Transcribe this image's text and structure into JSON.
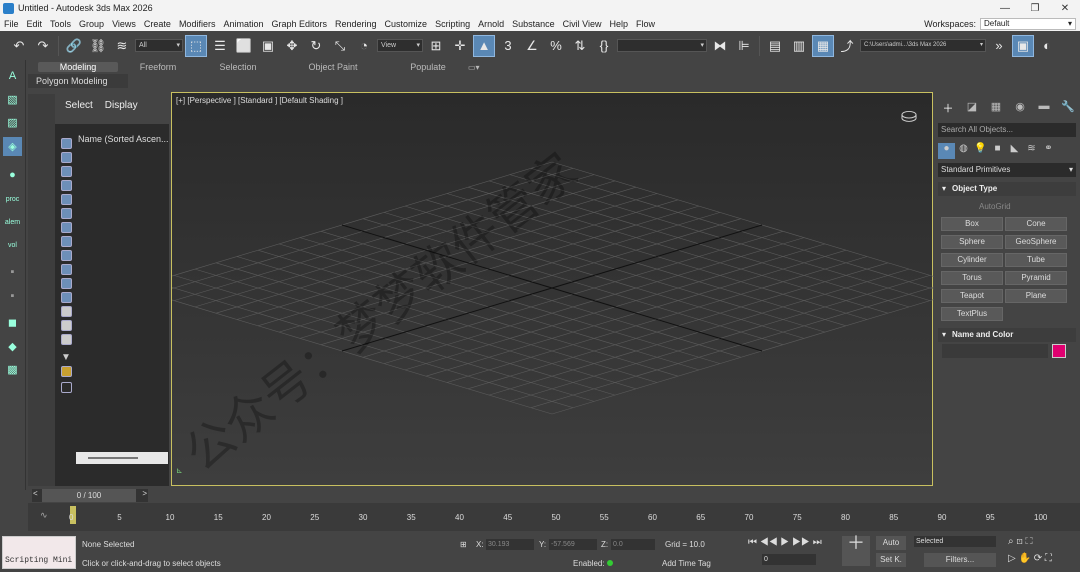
{
  "window": {
    "title": "Untitled - Autodesk 3ds Max 2026"
  },
  "menu": [
    "File",
    "Edit",
    "Tools",
    "Group",
    "Views",
    "Create",
    "Modifiers",
    "Animation",
    "Graph Editors",
    "Rendering",
    "Customize",
    "Scripting",
    "Arnold",
    "Substance",
    "Civil View",
    "Help",
    "Flow"
  ],
  "workspace": {
    "label": "Workspaces:",
    "value": "Default"
  },
  "toolbar": {
    "filter": "All",
    "refcoord": "View",
    "path": "C:\\Users\\admi...\\3ds Max 2026"
  },
  "ribbon": {
    "tabs": [
      "Modeling",
      "Freeform",
      "Selection",
      "Object Paint",
      "Populate"
    ],
    "sub": "Polygon Modeling"
  },
  "scene_explorer": {
    "tabs": [
      "Select",
      "Display"
    ],
    "column": "Name (Sorted Ascen..."
  },
  "viewport": {
    "label": "[+] [Perspective ] [Standard ] [Default Shading ]",
    "watermark": "公众号：梦梦软件管家"
  },
  "command_panel": {
    "search_placeholder": "Search All Objects...",
    "category": "Standard Primitives",
    "object_type_header": "Object Type",
    "autogrid": "AutoGrid",
    "buttons": [
      "Box",
      "Cone",
      "Sphere",
      "GeoSphere",
      "Cylinder",
      "Tube",
      "Torus",
      "Pyramid",
      "Teapot",
      "Plane",
      "TextPlus"
    ],
    "name_color_header": "Name and Color",
    "color": "#e00070"
  },
  "timeline": {
    "slider": "0 / 100",
    "ticks": [
      "0",
      "5",
      "10",
      "15",
      "20",
      "25",
      "30",
      "35",
      "40",
      "45",
      "50",
      "55",
      "60",
      "65",
      "70",
      "75",
      "80",
      "85",
      "90",
      "95",
      "100"
    ]
  },
  "status": {
    "script": "Scripting Mini",
    "selection": "None Selected",
    "prompt": "Click or click-and-drag to select objects",
    "x_label": "X:",
    "x_val": "30.193",
    "y_label": "Y:",
    "y_val": "-57.569",
    "z_label": "Z:",
    "z_val": "0.0",
    "grid": "Grid = 10.0",
    "enabled": "Enabled:",
    "add_time_tag": "Add Time Tag",
    "auto": "Auto",
    "setk": "Set K.",
    "selected": "Selected",
    "filters": "Filters...",
    "frame": "0"
  }
}
